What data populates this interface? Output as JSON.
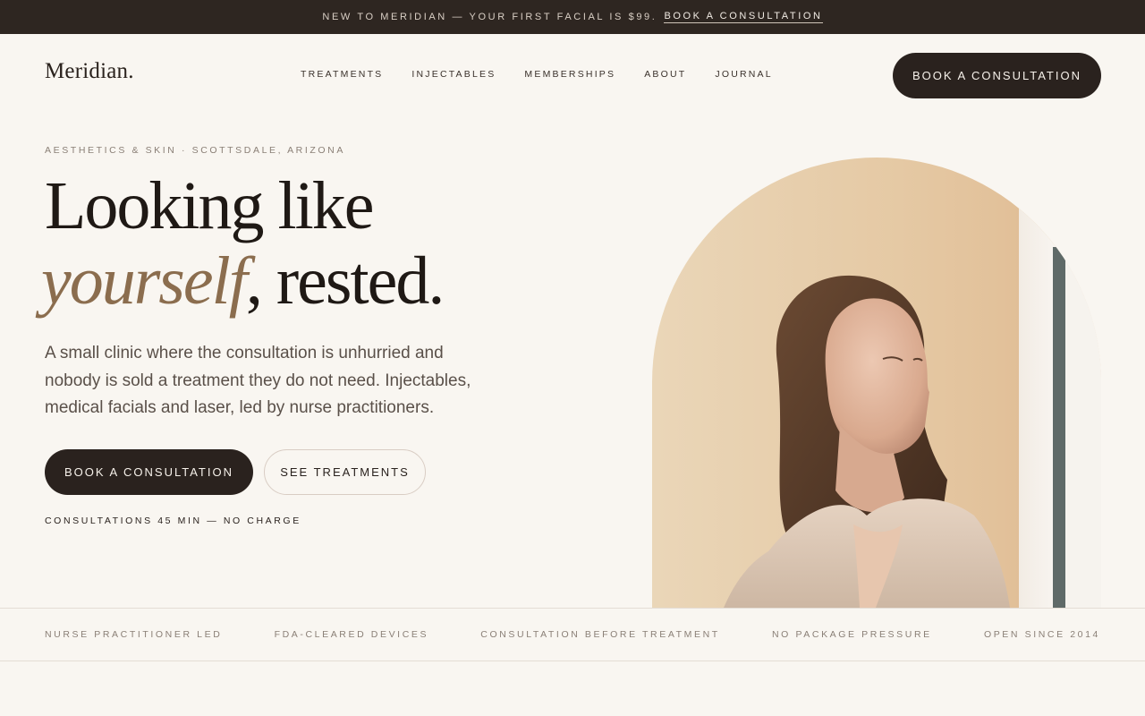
{
  "announcement": {
    "text": "New to Meridian — your first facial is $99.",
    "link_label": "Book a consultation"
  },
  "header": {
    "logo": "Meridian.",
    "nav": [
      "Treatments",
      "Injectables",
      "Memberships",
      "About",
      "Journal"
    ],
    "cta_label": "Book a consultation"
  },
  "hero": {
    "eyebrow": "Aesthetics & Skin · Scottsdale, Arizona",
    "headline_line1": "Looking like",
    "headline_accent": "yourself",
    "headline_rest": ", rested.",
    "lede": "A small clinic where the consultation is unhurried and nobody is sold a treatment they do not need. Injectables, medical facials and laser, led by nurse practitioners.",
    "primary_cta": "Book a consultation",
    "secondary_cta": "See treatments",
    "note": "Consultations 45 min — no charge"
  },
  "trust_items": [
    "Nurse practitioner led",
    "FDA-cleared devices",
    "Consultation before treatment",
    "No package pressure",
    "Open since 2014"
  ],
  "colors": {
    "background": "#f9f6f1",
    "dark": "#2a221e",
    "accent": "#8b6d4e",
    "muted": "#8a7f76"
  }
}
